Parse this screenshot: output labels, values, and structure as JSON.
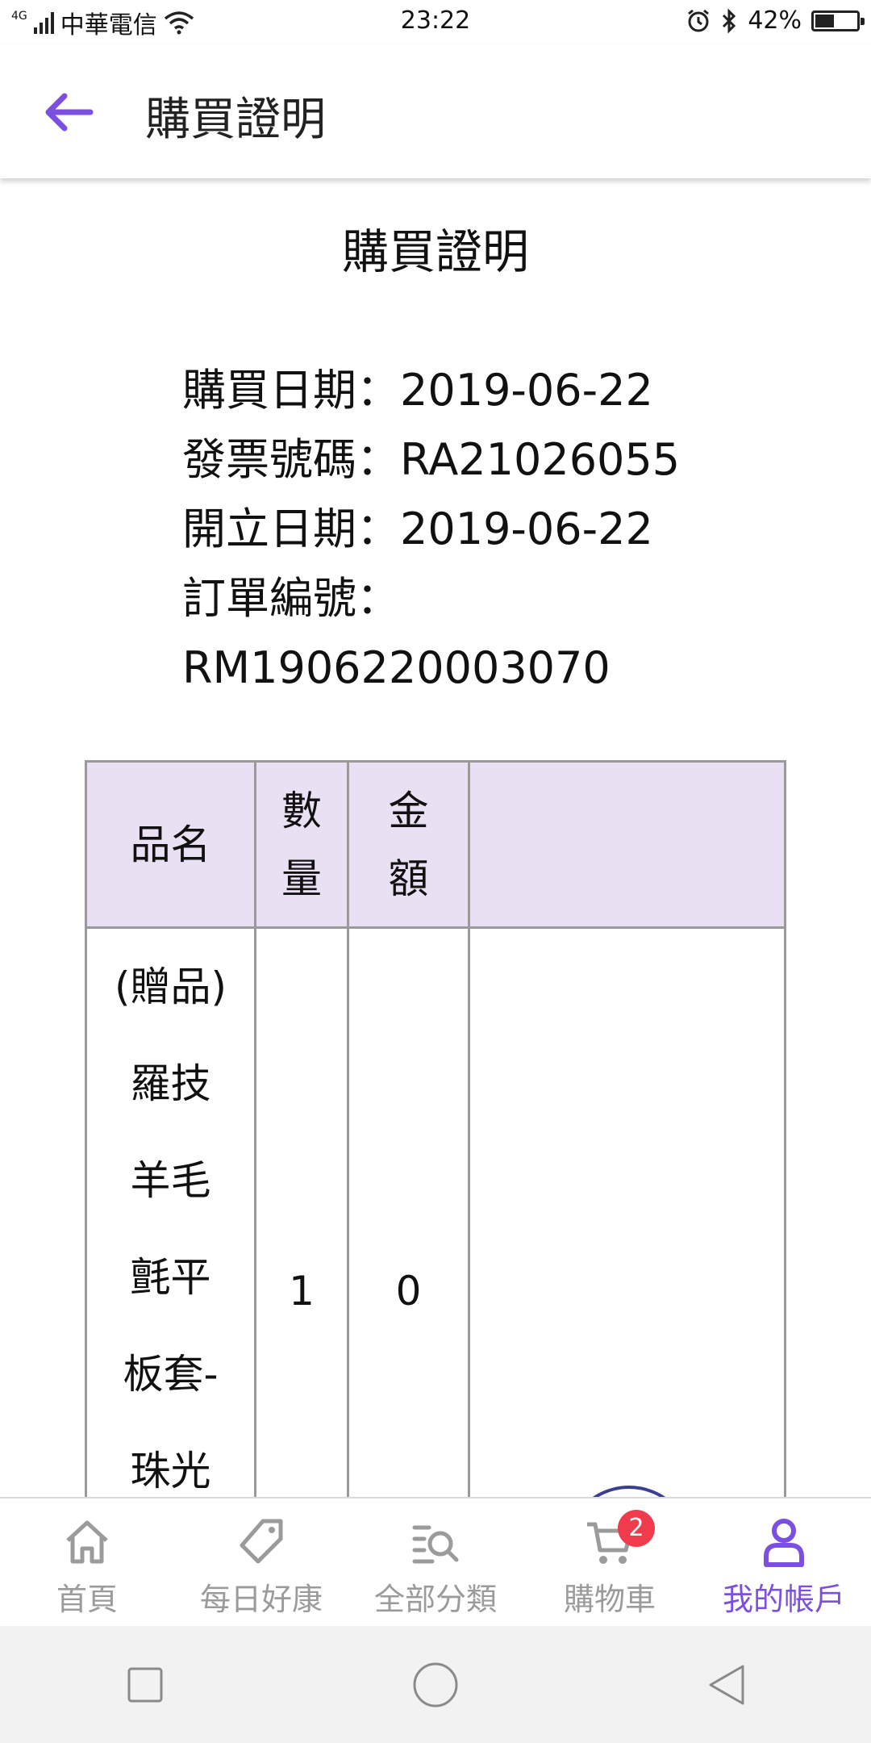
{
  "status_bar": {
    "network": "4G",
    "carrier": "中華電信",
    "time": "23:22",
    "battery": "42%",
    "battery_level": 0.42
  },
  "app_bar": {
    "title": "購買證明"
  },
  "document": {
    "title": "購買證明",
    "purchase_date": "購買日期：2019-06-22",
    "invoice_number": "發票號碼：RA21026055",
    "issue_date": "開立日期：2019-06-22",
    "order_number_label": "訂單編號：",
    "order_number": "RM1906220003070"
  },
  "table": {
    "headers": {
      "name": "品名",
      "qty_line1": "數",
      "qty_line2": "量",
      "amount_line1": "金",
      "amount_line2": "額",
      "extra": ""
    },
    "rows": [
      {
        "name_lines": [
          "(贈品)",
          "羅技",
          "羊毛",
          "氈平",
          "板套-",
          "珠光"
        ],
        "qty": "1",
        "amount": "0",
        "extra": ""
      }
    ]
  },
  "bottom_nav": {
    "items": [
      {
        "label": "首頁",
        "icon": "home-icon"
      },
      {
        "label": "每日好康",
        "icon": "tag-icon"
      },
      {
        "label": "全部分類",
        "icon": "category-search-icon"
      },
      {
        "label": "購物車",
        "icon": "cart-icon",
        "badge": "2"
      },
      {
        "label": "我的帳戶",
        "icon": "user-icon",
        "active": true
      }
    ]
  },
  "colors": {
    "accent": "#7b4fe0",
    "header_bg": "#e9e1f3",
    "badge": "#ef3b4c"
  }
}
